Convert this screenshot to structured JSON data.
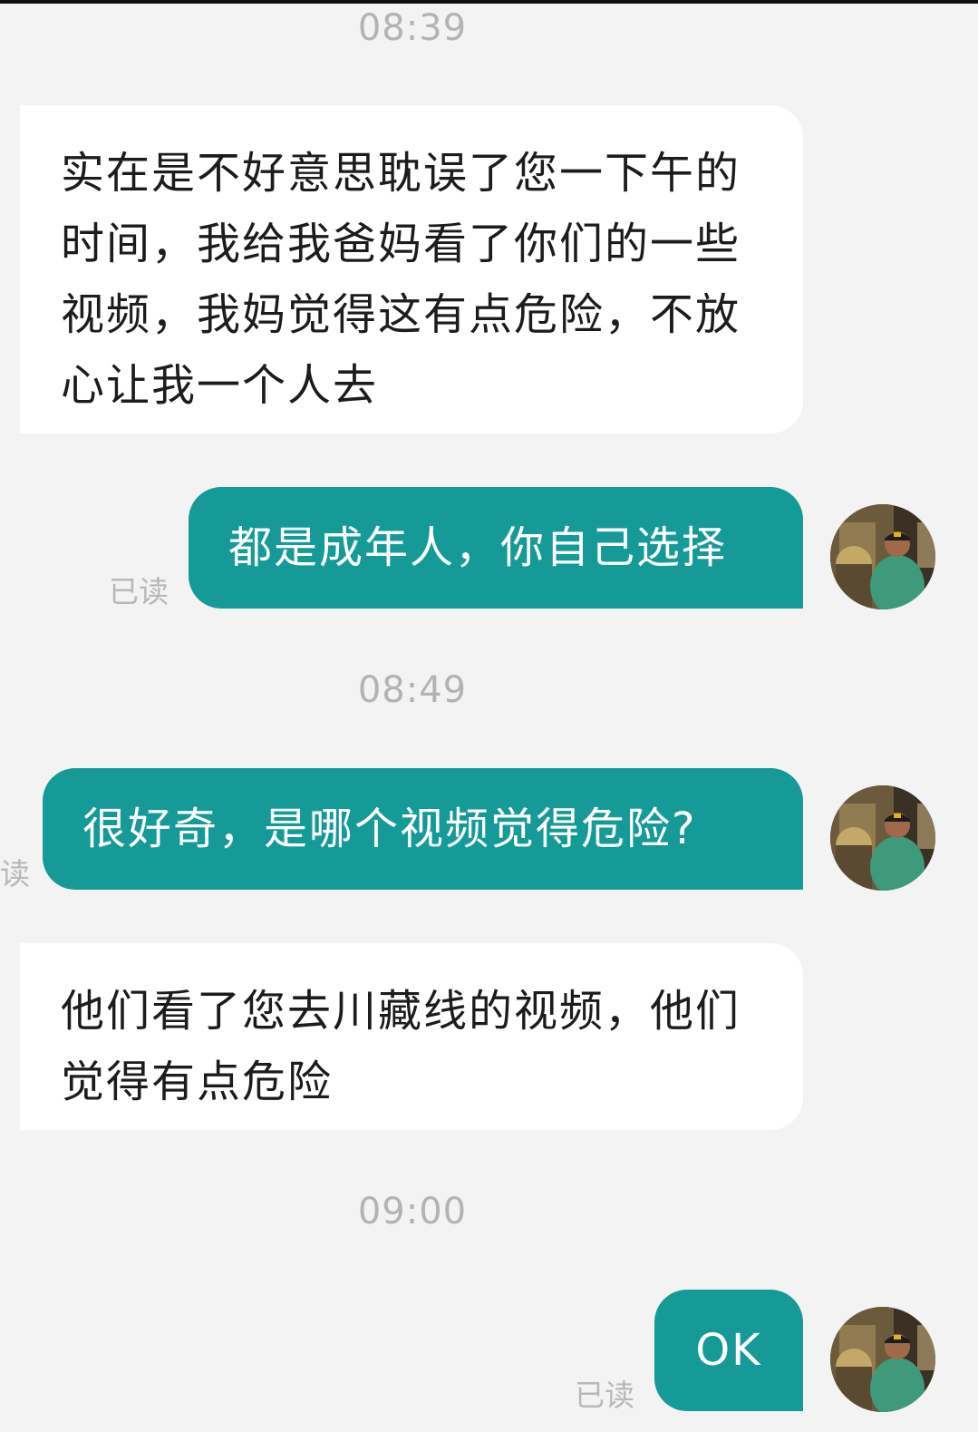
{
  "chat": {
    "messages": [
      {
        "type": "time",
        "text": "08:39"
      },
      {
        "type": "received",
        "text": "实在是不好意思耽误了您一下午的时间，我给我爸妈看了你们的一些视频，我妈觉得这有点危险，不放心让我一个人去"
      },
      {
        "type": "sent",
        "text": "都是成年人，你自己选择",
        "status": "已读"
      },
      {
        "type": "time",
        "text": "08:49"
      },
      {
        "type": "sent",
        "text": "很好奇，是哪个视频觉得危险?",
        "status": "读"
      },
      {
        "type": "received",
        "text": "他们看了您去川藏线的视频，他们觉得有点危险"
      },
      {
        "type": "time",
        "text": "09:00"
      },
      {
        "type": "sent",
        "text": "OK",
        "status": "已读"
      }
    ]
  },
  "avatar": {
    "icon": "user-avatar-photo"
  },
  "colors": {
    "background": "#f3f3f3",
    "sent_bubble": "#159a98",
    "received_bubble": "#ffffff",
    "timestamp": "#b3b3b3",
    "read_status": "#b8b8b8"
  }
}
